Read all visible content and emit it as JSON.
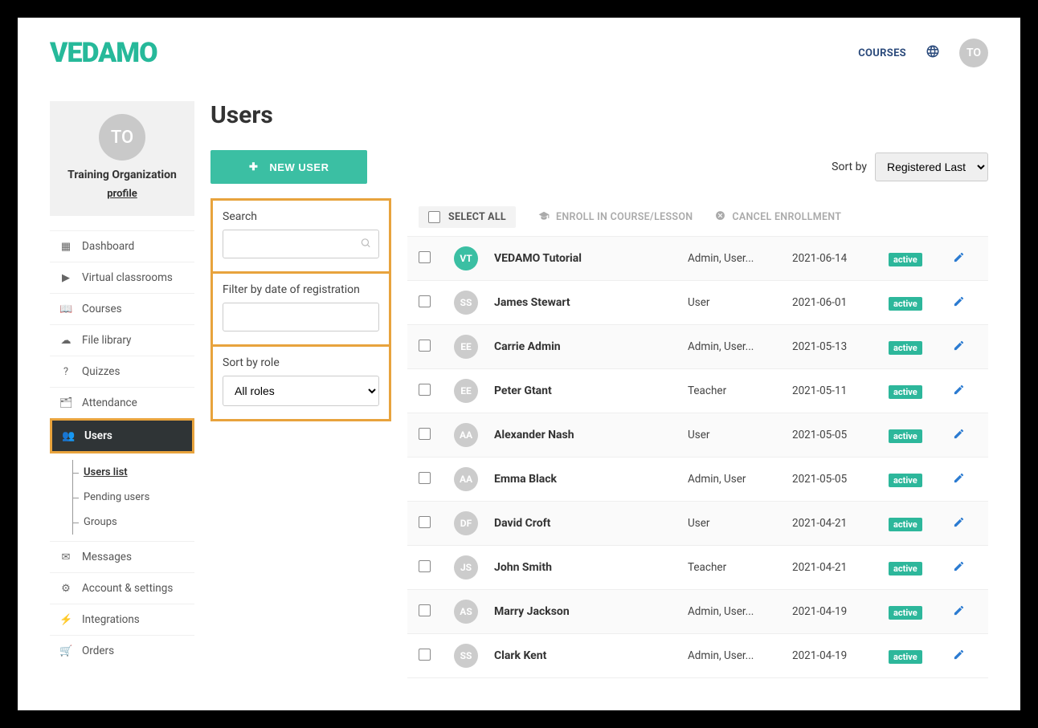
{
  "header": {
    "logo": "VEDAMO",
    "courses_link": "COURSES",
    "avatar_initials": "TO"
  },
  "sidebar": {
    "avatar_initials": "TO",
    "org_name": "Training Organization",
    "profile_link": "profile",
    "nav": [
      {
        "label": "Dashboard"
      },
      {
        "label": "Virtual classrooms"
      },
      {
        "label": "Courses"
      },
      {
        "label": "File library"
      },
      {
        "label": "Quizzes"
      },
      {
        "label": "Attendance"
      },
      {
        "label": "Users",
        "active": true
      },
      {
        "label": "Messages"
      },
      {
        "label": "Account & settings"
      },
      {
        "label": "Integrations"
      },
      {
        "label": "Orders"
      }
    ],
    "sub_nav": [
      {
        "label": "Users list",
        "active": true
      },
      {
        "label": "Pending users"
      },
      {
        "label": "Groups"
      }
    ]
  },
  "page": {
    "title": "Users",
    "new_user_btn": "NEW USER",
    "sort_label": "Sort by",
    "sort_selected": "Registered Last"
  },
  "filters": {
    "search_label": "Search",
    "date_label": "Filter by date of registration",
    "role_label": "Sort by role",
    "role_selected": "All roles"
  },
  "bulk": {
    "select_all": "SELECT ALL",
    "enroll": "ENROLL IN COURSE/LESSON",
    "cancel": "CANCEL ENROLLMENT"
  },
  "users": [
    {
      "initials": "VT",
      "avatar_color": "#3bbfa3",
      "name": "VEDAMO Tutorial",
      "role": "Admin, User...",
      "date": "2021-06-14",
      "status": "active"
    },
    {
      "initials": "SS",
      "avatar_color": "#cccccc",
      "name": "James Stewart",
      "role": "User",
      "date": "2021-06-01",
      "status": "active"
    },
    {
      "initials": "EE",
      "avatar_color": "#cccccc",
      "name": "Carrie Admin",
      "role": "Admin, User...",
      "date": "2021-05-13",
      "status": "active"
    },
    {
      "initials": "EE",
      "avatar_color": "#cccccc",
      "name": "Peter Gtant",
      "role": "Teacher",
      "date": "2021-05-11",
      "status": "active"
    },
    {
      "initials": "AA",
      "avatar_color": "#cccccc",
      "name": "Alexander Nash",
      "role": "User",
      "date": "2021-05-05",
      "status": "active"
    },
    {
      "initials": "AA",
      "avatar_color": "#cccccc",
      "name": "Emma Black",
      "role": "Admin, User",
      "date": "2021-05-05",
      "status": "active"
    },
    {
      "initials": "DF",
      "avatar_color": "#cccccc",
      "name": "David Croft",
      "role": "User",
      "date": "2021-04-21",
      "status": "active"
    },
    {
      "initials": "JS",
      "avatar_color": "#cccccc",
      "name": "John Smith",
      "role": "Teacher",
      "date": "2021-04-21",
      "status": "active"
    },
    {
      "initials": "AS",
      "avatar_color": "#cccccc",
      "name": "Marry Jackson",
      "role": "Admin, User...",
      "date": "2021-04-19",
      "status": "active"
    },
    {
      "initials": "SS",
      "avatar_color": "#cccccc",
      "name": "Clark Kent",
      "role": "Admin, User...",
      "date": "2021-04-19",
      "status": "active"
    }
  ]
}
